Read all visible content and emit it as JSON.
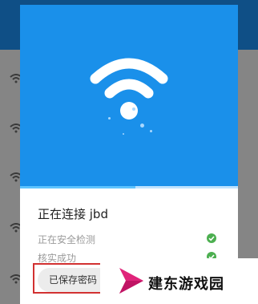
{
  "dialog": {
    "connecting_text": "正在连接 jbd",
    "progress_fraction": 0.53,
    "steps": [
      {
        "label": "正在安全检测",
        "status": "done"
      },
      {
        "label": "核实成功",
        "status": "done"
      }
    ],
    "saved_button_label": "已保存密码"
  },
  "watermark": {
    "text": "建东游戏园"
  },
  "icons": {
    "main": "wifi-icon",
    "step_status": "check-circle-icon",
    "background_list": "wifi-signal-icon"
  },
  "colors": {
    "header_blue": "#1a90ea",
    "success_green": "#4caf50",
    "highlight_red": "#d23131",
    "watermark_pink": "#e0247a"
  }
}
